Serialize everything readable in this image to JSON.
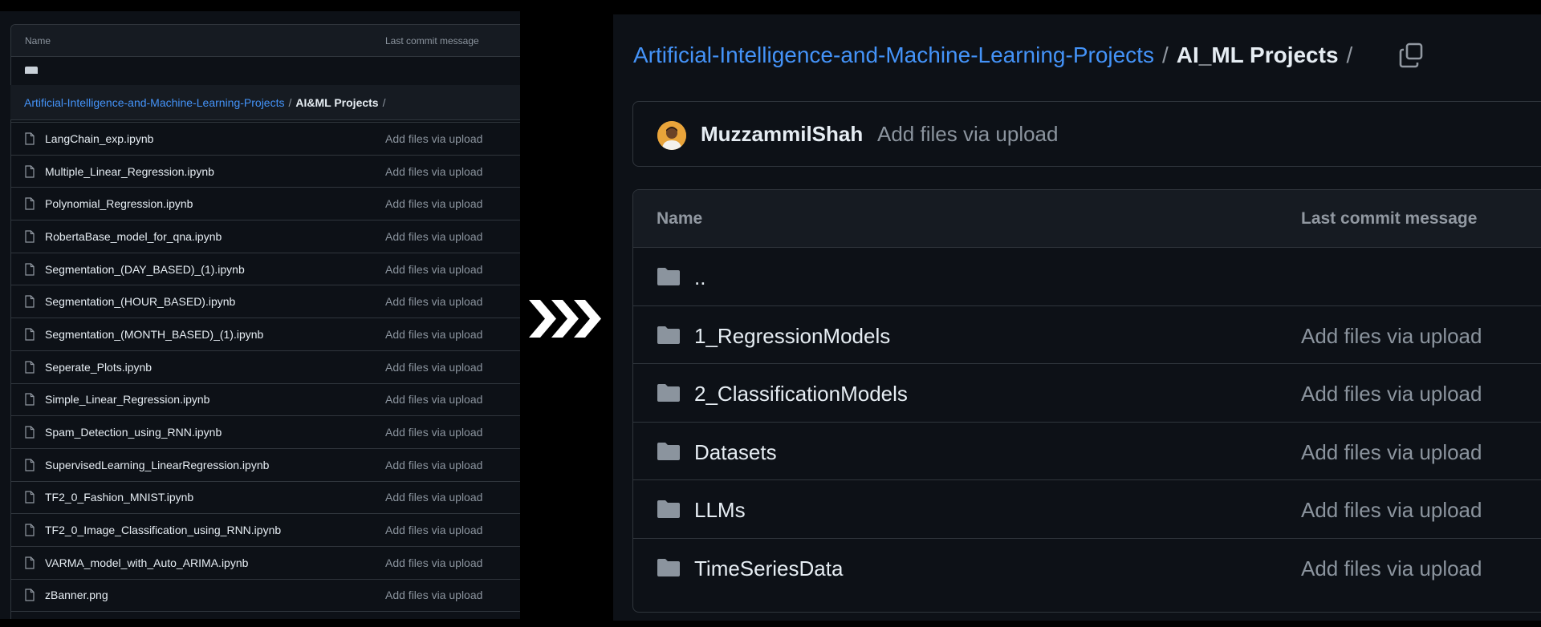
{
  "left": {
    "header": {
      "name_col": "Name",
      "commit_col": "Last commit message"
    },
    "breadcrumb": {
      "repo": "Artificial-Intelligence-and-Machine-Learning-Projects",
      "separator": "/",
      "current": "AI&ML Projects",
      "trailing": "/"
    },
    "files": [
      {
        "name": "LangChain_exp.ipynb",
        "commit": "Add files via upload"
      },
      {
        "name": "Multiple_Linear_Regression.ipynb",
        "commit": "Add files via upload"
      },
      {
        "name": "Polynomial_Regression.ipynb",
        "commit": "Add files via upload"
      },
      {
        "name": "RobertaBase_model_for_qna.ipynb",
        "commit": "Add files via upload"
      },
      {
        "name": "Segmentation_(DAY_BASED)_(1).ipynb",
        "commit": "Add files via upload"
      },
      {
        "name": "Segmentation_(HOUR_BASED).ipynb",
        "commit": "Add files via upload"
      },
      {
        "name": "Segmentation_(MONTH_BASED)_(1).ipynb",
        "commit": "Add files via upload"
      },
      {
        "name": "Seperate_Plots.ipynb",
        "commit": "Add files via upload"
      },
      {
        "name": "Simple_Linear_Regression.ipynb",
        "commit": "Add files via upload"
      },
      {
        "name": "Spam_Detection_using_RNN.ipynb",
        "commit": "Add files via upload"
      },
      {
        "name": "SupervisedLearning_LinearRegression.ipynb",
        "commit": "Add files via upload"
      },
      {
        "name": "TF2_0_Fashion_MNIST.ipynb",
        "commit": "Add files via upload"
      },
      {
        "name": "TF2_0_Image_Classification_using_RNN.ipynb",
        "commit": "Add files via upload"
      },
      {
        "name": "VARMA_model_with_Auto_ARIMA.ipynb",
        "commit": "Add files via upload"
      },
      {
        "name": "zBanner.png",
        "commit": "Add files via upload"
      }
    ]
  },
  "right": {
    "breadcrumb": {
      "repo": "Artificial-Intelligence-and-Machine-Learning-Projects",
      "separator": "/",
      "current": "AI_ML Projects",
      "trailing": "/"
    },
    "commit": {
      "author": "MuzzammilShah",
      "message": "Add files via upload"
    },
    "header": {
      "name_col": "Name",
      "commit_col": "Last commit message"
    },
    "rows": [
      {
        "name": "..",
        "commit": ""
      },
      {
        "name": "1_RegressionModels",
        "commit": "Add files via upload"
      },
      {
        "name": "2_ClassificationModels",
        "commit": "Add files via upload"
      },
      {
        "name": "Datasets",
        "commit": "Add files via upload"
      },
      {
        "name": "LLMs",
        "commit": "Add files via upload"
      },
      {
        "name": "TimeSeriesData",
        "commit": "Add files via upload"
      }
    ]
  },
  "colors": {
    "background": "#0d1117",
    "link": "#4493f8",
    "muted": "#8b949e",
    "border": "#30363d",
    "folder": "#8b949e"
  },
  "icons": {
    "file": "file-icon",
    "folder": "folder-icon",
    "copy": "copy-icon",
    "arrow": "chevron-right-icon"
  }
}
